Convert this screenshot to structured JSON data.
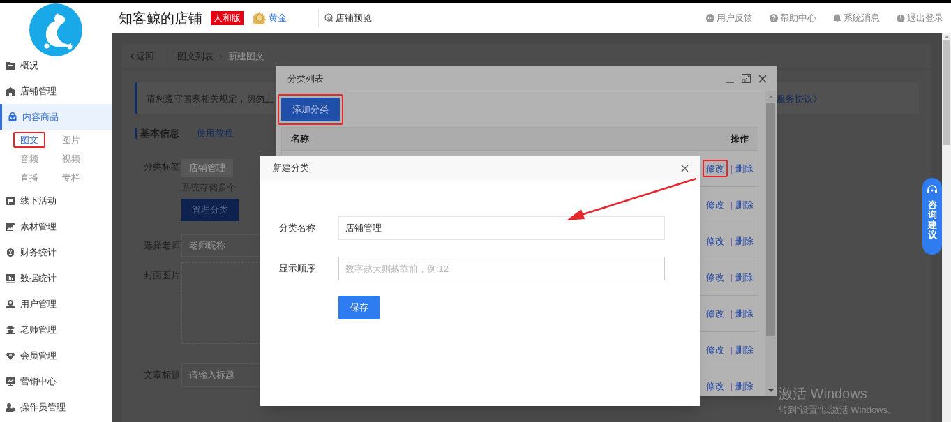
{
  "header": {
    "shop_name": "知客鲸的店铺",
    "edition_badge": "人和版",
    "membership": "黄金",
    "preview_link": "店铺预览",
    "links": [
      "用户反馈",
      "帮助中心",
      "系统消息",
      "退出登录"
    ]
  },
  "sidebar": {
    "items": [
      {
        "label": "概况",
        "selected": false
      },
      {
        "label": "店铺管理",
        "selected": false
      },
      {
        "label": "内容商品",
        "selected": true,
        "children": [
          {
            "label": "图文",
            "selected": true,
            "highlighted": true
          },
          {
            "label": "图片",
            "selected": false,
            "highlighted": false
          },
          {
            "label": "音频",
            "selected": false,
            "highlighted": false
          },
          {
            "label": "视频",
            "selected": false,
            "highlighted": false
          },
          {
            "label": "直播",
            "selected": false,
            "highlighted": false
          },
          {
            "label": "专栏",
            "selected": false,
            "highlighted": false
          }
        ]
      },
      {
        "label": "线下活动",
        "selected": false
      },
      {
        "label": "素材管理",
        "selected": false
      },
      {
        "label": "财务统计",
        "selected": false
      },
      {
        "label": "数据统计",
        "selected": false
      },
      {
        "label": "用户管理",
        "selected": false
      },
      {
        "label": "老师管理",
        "selected": false
      },
      {
        "label": "会员管理",
        "selected": false
      },
      {
        "label": "营销中心",
        "selected": false
      },
      {
        "label": "操作员管理",
        "selected": false
      }
    ]
  },
  "page": {
    "back": "返回",
    "breadcrumb": [
      "图文列表",
      "新建图文"
    ],
    "notice": {
      "text": "请您遵守国家相关规定，切勿上",
      "link": "服务协议》"
    },
    "section_title": "基本信息",
    "tutorial_link": "使用教程",
    "form": {
      "category": {
        "label": "分类标签",
        "tag": "店铺管理",
        "hint": "系统存储多个",
        "button": "管理分类"
      },
      "teacher": {
        "label": "选择老师",
        "placeholder": "老师昵称"
      },
      "cover": {
        "label": "封面图片"
      },
      "title": {
        "label": "文章标题",
        "placeholder": "请输入标题"
      }
    }
  },
  "category_list": {
    "title": "分类列表",
    "add_button": {
      "label": "添加分类",
      "highlighted": true
    },
    "columns": [
      "名称",
      "操作"
    ],
    "separator": "|",
    "rows": [
      {
        "actions": [
          "修改",
          "删除"
        ],
        "highlighted": true
      },
      {
        "actions": [
          "修改",
          "删除"
        ],
        "highlighted": false
      },
      {
        "actions": [
          "修改",
          "删除"
        ],
        "highlighted": false
      },
      {
        "actions": [
          "修改",
          "删除"
        ],
        "highlighted": false
      },
      {
        "actions": [
          "修改",
          "删除"
        ],
        "highlighted": false
      },
      {
        "actions": [
          "修改",
          "删除"
        ],
        "highlighted": false
      },
      {
        "actions": [
          "修改",
          "删除"
        ],
        "highlighted": false
      }
    ]
  },
  "new_category": {
    "title": "新建分类",
    "fields": [
      {
        "label": "分类名称",
        "value": "店铺管理"
      },
      {
        "label": "显示顺序",
        "placeholder": "数字越大则越靠前，例:12"
      }
    ],
    "save_button": "保存"
  },
  "consult_button": "咨询建议",
  "windows_notice": {
    "title": "激活 Windows",
    "text": "转到“设置”以激活 Windows。"
  }
}
